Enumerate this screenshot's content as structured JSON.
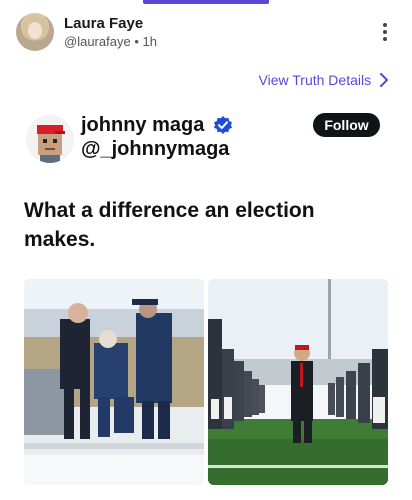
{
  "post": {
    "author_name": "Laura Faye",
    "author_handle": "@laurafaye",
    "separator": "•",
    "time": "1h",
    "view_details_label": "View Truth Details"
  },
  "embedded_tweet": {
    "name": "johnny maga",
    "handle": "@_johnnymaga",
    "follow_label": "Follow",
    "text": "What a difference an election makes."
  },
  "colors": {
    "accent": "#5a48d6",
    "verified_blue": "#1d4ed8",
    "follow_bg": "#0f1419"
  }
}
